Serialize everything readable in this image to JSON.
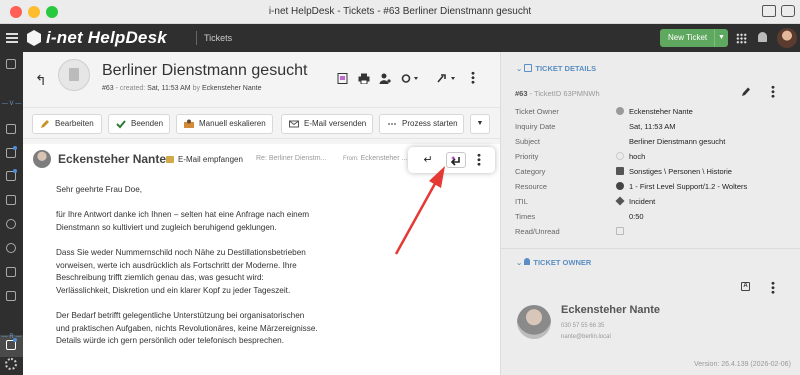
{
  "window": {
    "title": "i-net HelpDesk - Tickets - #63 Berliner Dienstmann gesucht"
  },
  "appbar": {
    "brand": "i-net HelpDesk",
    "module": "Tickets",
    "new_ticket_label": "New Ticket",
    "accent": "#5fa85f"
  },
  "leftnav": {
    "section_v": "— V —",
    "section_r": "— R —",
    "icons": [
      "apps-icon",
      "document-icon",
      "document-icon",
      "box-icon",
      "archive-icon",
      "stack-icon",
      "cloud-icon",
      "archive-icon",
      "list-icon",
      "document-icon"
    ]
  },
  "ticket": {
    "title": "Berliner Dienstmann gesucht",
    "id_prefix": "#63",
    "created_label": "- created:",
    "created_value": "Sat, 11:53 AM",
    "by_label": "by",
    "creator": "Eckensteher Nante"
  },
  "actions": [
    {
      "label": "Bearbeiten",
      "icon": "pencil-icon"
    },
    {
      "label": "Beenden",
      "icon": "check-icon"
    },
    {
      "label": "Manuell eskalieren",
      "icon": "escalate-icon"
    },
    {
      "label": "E-Mail versenden",
      "icon": "mail-icon"
    },
    {
      "label": "Prozess starten",
      "icon": "process-icon"
    }
  ],
  "email": {
    "sender": "Eckensteher Nante",
    "type_label": "E-Mail empfangen",
    "subject": "Re: Berliner Dienstm...",
    "from_label": "From:",
    "from_value": "Eckensteher ...",
    "body": [
      "Sehr geehrte Frau Doe,",
      "für Ihre Antwort danke ich Ihnen – selten hat eine Anfrage nach einem\nDienstmann so kultiviert und zugleich beruhigend geklungen.",
      "Dass Sie weder Nummernschild noch Nähe zu Destillationsbetrieben\nvorweisen, werte ich ausdrücklich als Fortschritt der Moderne. Ihre\nBeschreibung trifft ziemlich genau das, was gesucht wird:\nVerlässlichkeit, Diskretion und ein klarer Kopf zu jeder Tageszeit.",
      "Der Bedarf betrifft gelegentliche Unterstützung bei organisatorischen\nund praktischen Aufgaben, nichts Revolutionäres, keine Märzereignisse.\nDetails würde ich gern persönlich oder telefonisch besprechen."
    ]
  },
  "details": {
    "heading": "TICKET DETAILS",
    "id_prefix": "#63",
    "id_suffix": "- TicketID 63PMNWh",
    "fields": [
      {
        "label": "Ticket Owner",
        "value": "Eckensteher Nante"
      },
      {
        "label": "Inquiry Date",
        "value": "Sat, 11:53 AM"
      },
      {
        "label": "Subject",
        "value": "Berliner Dienstmann gesucht"
      },
      {
        "label": "Priority",
        "value": "hoch"
      },
      {
        "label": "Category",
        "value": "Sonstiges \\ Personen \\ Historie"
      },
      {
        "label": "Resource",
        "value": "1 - First Level Support/1.2 - Wolters"
      },
      {
        "label": "ITIL",
        "value": "Incident"
      },
      {
        "label": "Times",
        "value": "0:50"
      },
      {
        "label": "Read/Unread",
        "value": ""
      }
    ]
  },
  "owner": {
    "heading": "TICKET OWNER",
    "name": "Eckensteher Nante",
    "phone": "030 57 55 66 35",
    "email": "nante@berlin.local"
  },
  "version": "Version: 26.4.139 (2026-02-06)",
  "colors": {
    "section_blue": "#5a8ec4",
    "annotation_red": "#e53935"
  }
}
